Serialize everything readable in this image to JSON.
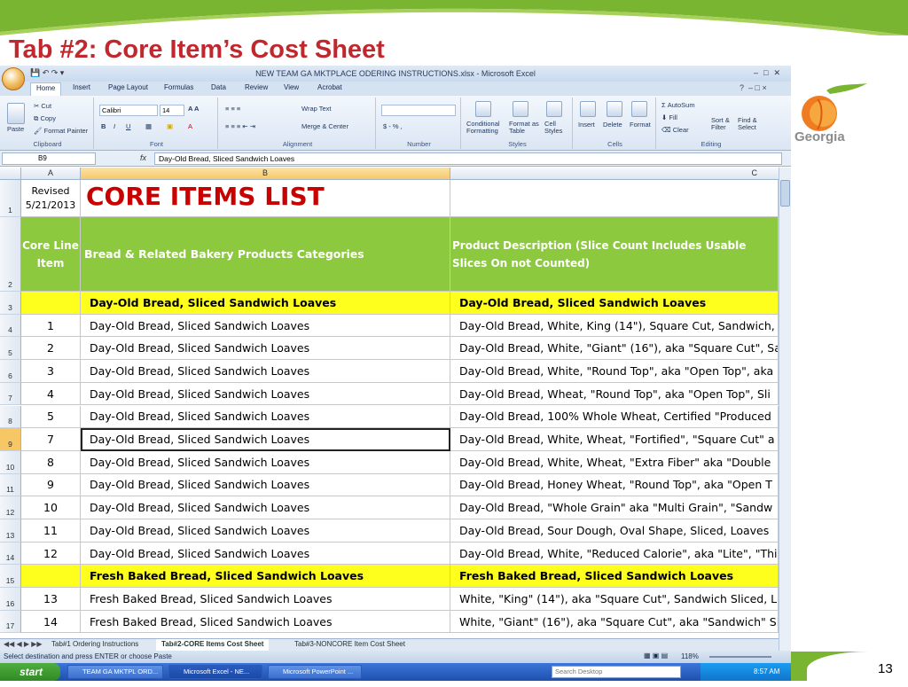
{
  "slide": {
    "title": "Tab #2: Core Item’s Cost Sheet",
    "page_number": "13",
    "logo_text": "Georgia",
    "accent_color": "#7ab531",
    "title_color": "#c0282d"
  },
  "excel": {
    "window_title": "NEW TEAM GA MKTPLACE ODERING INSTRUCTIONS.xlsx - Microsoft Excel",
    "ribbon_tabs": [
      "Home",
      "Insert",
      "Page Layout",
      "Formulas",
      "Data",
      "Review",
      "View",
      "Acrobat"
    ],
    "ribbon": {
      "clipboard": {
        "paste": "Paste",
        "cut": "Cut",
        "copy": "Copy",
        "format_painter": "Format Painter",
        "label": "Clipboard"
      },
      "font": {
        "name": "Calibri",
        "size": "14",
        "label": "Font"
      },
      "alignment": {
        "wrap_text": "Wrap Text",
        "merge_center": "Merge & Center",
        "label": "Alignment"
      },
      "number": {
        "currency": "$ - % ,",
        "label": "Number"
      },
      "styles": {
        "conditional": "Conditional Formatting",
        "format_table": "Format as Table",
        "cell_styles": "Cell Styles",
        "label": "Styles"
      },
      "cells": {
        "insert": "Insert",
        "delete": "Delete",
        "format": "Format",
        "label": "Cells"
      },
      "editing": {
        "autosum": "AutoSum",
        "fill": "Fill",
        "clear": "Clear",
        "sort_filter": "Sort & Filter",
        "find_select": "Find & Select",
        "label": "Editing"
      }
    },
    "name_box": "B9",
    "fx": "fx",
    "formula": "Day-Old Bread, Sliced Sandwich Loaves",
    "columns": [
      "A",
      "B",
      "C"
    ],
    "row1": {
      "num": "1",
      "a": "Revised 5/21/2013",
      "b": "CORE ITEMS LIST",
      "c": ""
    },
    "row2": {
      "num": "2",
      "a": "Core Line Item",
      "b": "Bread & Related Bakery Products Categories",
      "c": "Product Description (Slice Count Includes Usable Slices On not Counted)"
    },
    "rows": [
      {
        "num": "3",
        "a": "",
        "b": "Day-Old Bread, Sliced Sandwich Loaves",
        "c": "Day-Old Bread, Sliced Sandwich Loaves",
        "kind": "category"
      },
      {
        "num": "4",
        "a": "1",
        "b": "Day-Old Bread, Sliced Sandwich Loaves",
        "c": "Day-Old Bread, White, King (14\"), Square Cut, Sandwich, S"
      },
      {
        "num": "5",
        "a": "2",
        "b": "Day-Old Bread, Sliced Sandwich Loaves",
        "c": "Day-Old Bread, White, \"Giant\" (16\"), aka \"Square Cut\", Sa"
      },
      {
        "num": "6",
        "a": "3",
        "b": "Day-Old Bread, Sliced Sandwich Loaves",
        "c": "Day-Old Bread, White, \"Round Top\", aka \"Open Top\", aka"
      },
      {
        "num": "7",
        "a": "4",
        "b": "Day-Old Bread, Sliced Sandwich Loaves",
        "c": "Day-Old Bread, Wheat, \"Round Top\", aka \"Open Top\", Sli"
      },
      {
        "num": "8",
        "a": "5",
        "b": "Day-Old Bread, Sliced Sandwich Loaves",
        "c": "Day-Old Bread, 100% Whole Wheat, Certified \"Produced"
      },
      {
        "num": "9",
        "a": "7",
        "b": "Day-Old Bread, Sliced Sandwich Loaves",
        "c": "Day-Old Bread, White, Wheat, \"Fortified\", \"Square Cut\" a",
        "selected": true
      },
      {
        "num": "10",
        "a": "8",
        "b": "Day-Old Bread, Sliced Sandwich Loaves",
        "c": "Day-Old Bread, White, Wheat, \"Extra Fiber\" aka \"Double"
      },
      {
        "num": "11",
        "a": "9",
        "b": "Day-Old Bread, Sliced Sandwich Loaves",
        "c": "Day-Old Bread, Honey Wheat, \"Round Top\", aka \"Open T"
      },
      {
        "num": "12",
        "a": "10",
        "b": "Day-Old Bread, Sliced Sandwich Loaves",
        "c": "Day-Old Bread, \"Whole Grain\" aka \"Multi Grain\", \"Sandw"
      },
      {
        "num": "13",
        "a": "11",
        "b": "Day-Old Bread, Sliced Sandwich Loaves",
        "c": "Day-Old Bread, Sour Dough, Oval Shape, Sliced, Loaves"
      },
      {
        "num": "14",
        "a": "12",
        "b": "Day-Old Bread, Sliced Sandwich Loaves",
        "c": "Day-Old Bread, White, \"Reduced Calorie\", aka \"Lite\", \"Thi"
      },
      {
        "num": "15",
        "a": "",
        "b": "Fresh Baked Bread, Sliced Sandwich Loaves",
        "c": "Fresh Baked Bread, Sliced Sandwich Loaves",
        "kind": "category"
      },
      {
        "num": "16",
        "a": "13",
        "b": "Fresh Baked Bread, Sliced Sandwich Loaves",
        "c": "White, \"King\" (14\"), aka \"Square Cut\",  Sandwich Sliced,  L"
      },
      {
        "num": "17",
        "a": "14",
        "b": "Fresh Baked Bread, Sliced Sandwich Loaves",
        "c": "White, \"Giant\" (16\"), aka \"Square Cut\", aka \"Sandwich\" Sl"
      }
    ],
    "sheet_tabs": [
      "Tab#1 Ordering Instructions",
      "Tab#2-CORE Items Cost Sheet",
      "Tab#3-NONCORE Item Cost Sheet"
    ],
    "status_text": "Select destination and press ENTER or choose Paste",
    "zoom": "118%"
  },
  "taskbar": {
    "start": "start",
    "tasks": [
      "TEAM GA MKTPL ORD...",
      "Microsoft Excel - NE...",
      "Microsoft PowerPoint ..."
    ],
    "search_placeholder": "Search Desktop",
    "clock": "8:57 AM"
  }
}
